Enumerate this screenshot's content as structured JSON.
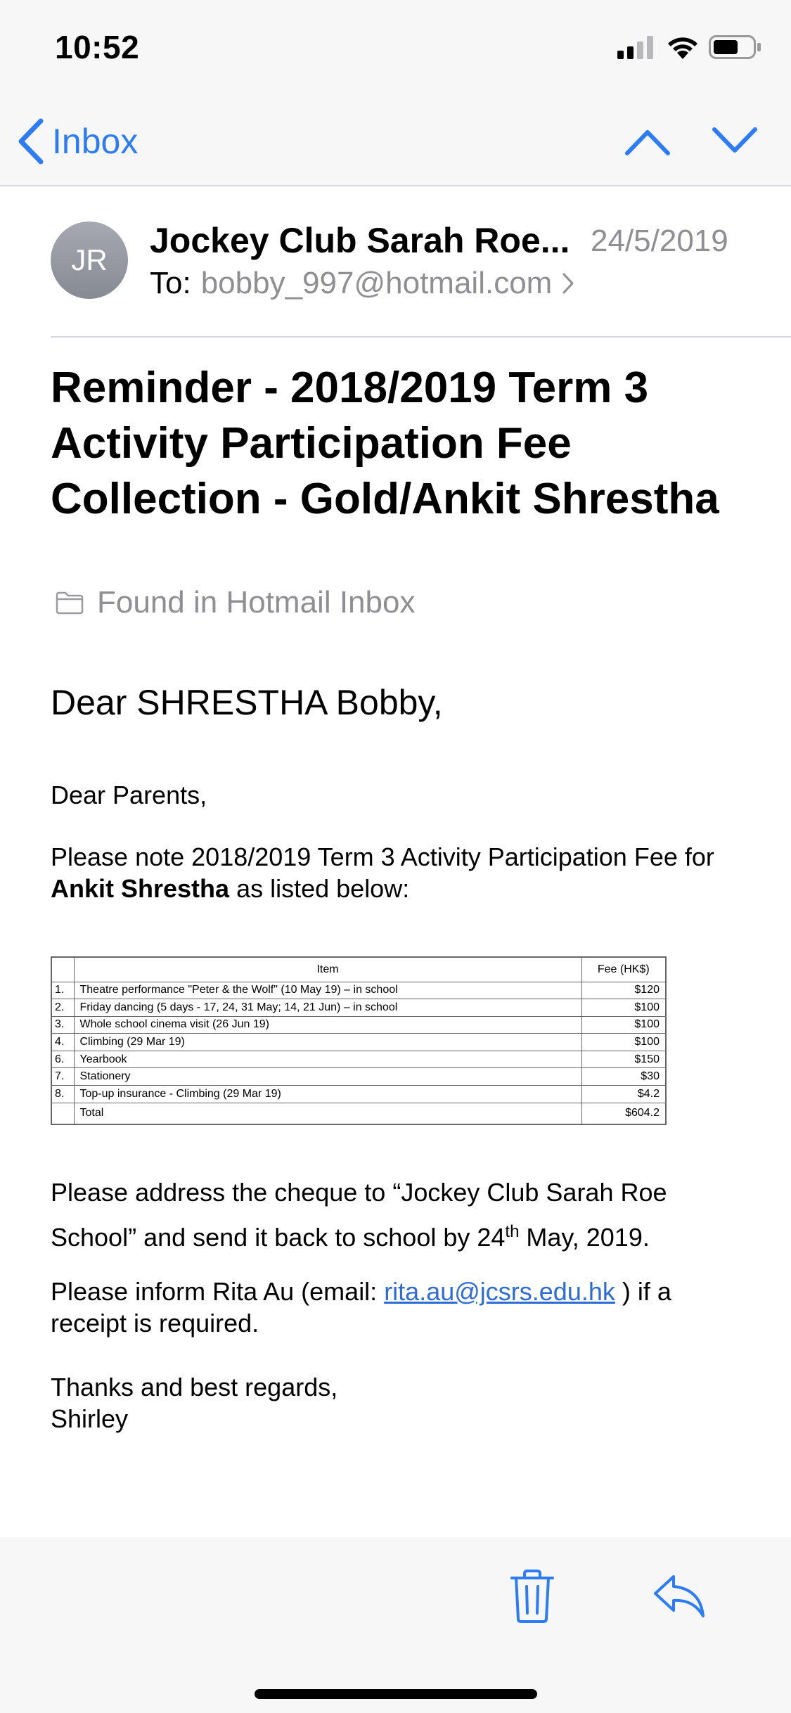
{
  "status_bar": {
    "time": "10:52"
  },
  "nav": {
    "back_label": "Inbox"
  },
  "header": {
    "avatar_initials": "JR",
    "sender": "Jockey Club Sarah Roe...",
    "date": "24/5/2019",
    "to_label": "To:",
    "to_address": "bobby_997@hotmail.com"
  },
  "subject": "Reminder - 2018/2019 Term 3 Activity Participation Fee Collection - Gold/Ankit Shrestha",
  "found_in": "Found in Hotmail Inbox",
  "body": {
    "greeting": "Dear SHRESTHA Bobby,",
    "salutation": "Dear Parents,",
    "intro_1": "Please note 2018/2019 Term 3 Activity Participation Fee for",
    "intro_name": "Ankit Shrestha",
    "intro_2": "as listed below:",
    "cheque_1": "Please address the cheque to “Jockey Club Sarah Roe School” and send it back to school by 24",
    "cheque_sup": "th",
    "cheque_2": " May, 2019.",
    "inform_1": "Please inform Rita Au (email: ",
    "inform_email": "rita.au@jcsrs.edu.hk",
    "inform_2": " ) if a receipt is required.",
    "closing": "Thanks and best regards,",
    "signature": "Shirley"
  },
  "fee_table": {
    "headers": {
      "item": "Item",
      "fee": "Fee (HK$)"
    },
    "rows": [
      {
        "num": "1.",
        "item": "Theatre performance \"Peter & the Wolf\" (10 May 19) – in school",
        "fee": "$120"
      },
      {
        "num": "2.",
        "item": "Friday dancing (5 days - 17, 24, 31 May; 14, 21 Jun) – in school",
        "fee": "$100"
      },
      {
        "num": "3.",
        "item": "Whole school cinema visit (26 Jun 19)",
        "fee": "$100"
      },
      {
        "num": "4.",
        "item": "Climbing (29 Mar 19)",
        "fee": "$100"
      },
      {
        "num": "6.",
        "item": "Yearbook",
        "fee": "$150"
      },
      {
        "num": "7.",
        "item": "Stationery",
        "fee": "$30"
      },
      {
        "num": "8.",
        "item": "Top-up insurance - Climbing (29 Mar 19)",
        "fee": "$4.2"
      }
    ],
    "total_label": "Total",
    "total_value": "$604.2"
  },
  "colors": {
    "accent": "#2d7cf6",
    "secondary_text": "#8e8e93",
    "avatar": "#9a9da5"
  },
  "icons": [
    "back-chevron-icon",
    "chevron-up-icon",
    "chevron-down-icon",
    "folder-icon",
    "trash-icon",
    "reply-icon"
  ]
}
